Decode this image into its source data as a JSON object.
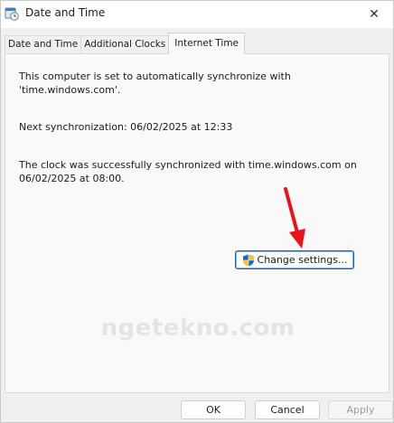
{
  "window": {
    "title": "Date and Time",
    "close_glyph": "✕"
  },
  "tabs": [
    {
      "label": "Date and Time",
      "active": false
    },
    {
      "label": "Additional Clocks",
      "active": false
    },
    {
      "label": "Internet Time",
      "active": true
    }
  ],
  "content": {
    "sync_line1": "This computer is set to automatically synchronize with",
    "sync_line2": "'time.windows.com'.",
    "next_sync": "Next synchronization: 06/02/2025 at 12:33",
    "success_line1": "The clock was successfully synchronized with time.windows.com on",
    "success_line2": "06/02/2025 at 08:00.",
    "change_settings_label": "Change settings..."
  },
  "watermark": "ngetekno.com",
  "buttons": {
    "ok": "OK",
    "cancel": "Cancel",
    "apply": "Apply"
  },
  "colors": {
    "accent": "#0067c0",
    "arrow": "#e8141a"
  },
  "icons": {
    "title": "date-time-icon",
    "shield": "uac-shield-icon"
  }
}
